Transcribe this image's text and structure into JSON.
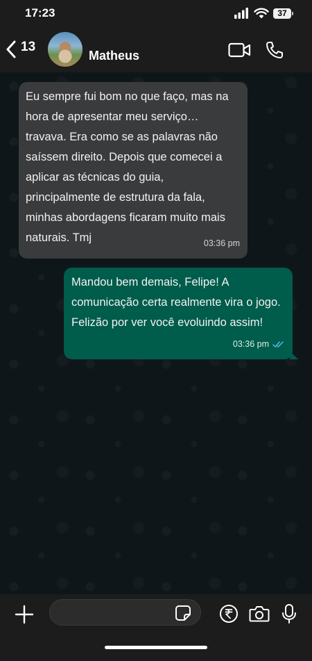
{
  "status_bar": {
    "time": "17:23",
    "battery_level": "37"
  },
  "header": {
    "unread_count": "13",
    "contact_name": "Matheus"
  },
  "messages": [
    {
      "direction": "incoming",
      "text": " Eu sempre fui bom no que faço, mas na hora de apresentar meu serviço… travava. Era como se as palavras não saíssem direito. Depois que comecei a aplicar as técnicas do guia, principalmente de estrutura da fala, minhas abordagens ficaram muito mais naturais. Tmj",
      "time": "03:36 pm"
    },
    {
      "direction": "outgoing",
      "text": " Mandou bem demais, Felipe! A comunicação certa realmente vira o jogo. Felizão por ver você evoluindo assim!",
      "time": "03:36 pm",
      "status": "read"
    }
  ],
  "input": {
    "value": "",
    "placeholder": ""
  },
  "icons": {
    "back": "chevron-left-icon",
    "video_call": "video-camera-icon",
    "voice_call": "phone-icon",
    "attach": "plus-icon",
    "sticker": "sticker-icon",
    "payment": "rupee-icon",
    "camera": "camera-icon",
    "mic": "microphone-icon",
    "read_receipt": "double-check-icon"
  },
  "colors": {
    "incoming_bubble": "#3a3b3c",
    "outgoing_bubble": "#005c4b",
    "read_ticks": "#53bdeb",
    "bars": "#1c1c1c"
  }
}
